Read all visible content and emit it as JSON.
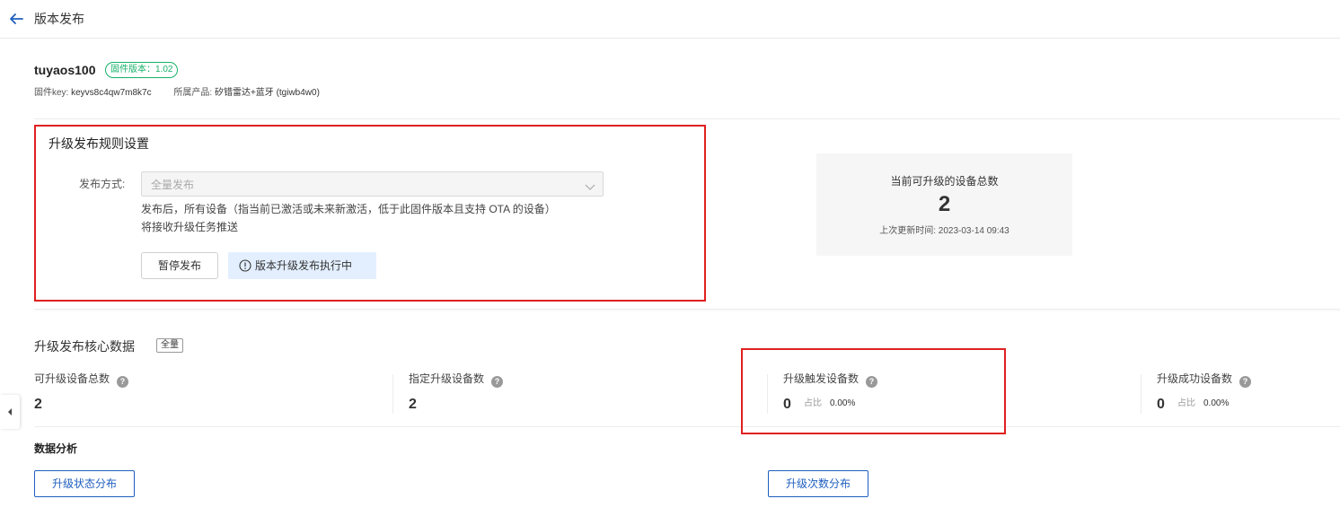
{
  "header": {
    "title": "版本发布"
  },
  "firmware": {
    "name": "tuyaos100",
    "version_tag": "固件版本：1.02",
    "key_label": "固件key:",
    "key_value": "keyvs8c4qw7m8k7c",
    "product_label": "所属产品:",
    "product_value": "矽错雷达+蓝牙 (tgiwb4w0)"
  },
  "release_rules": {
    "title": "升级发布规则设置",
    "method_label": "发布方式:",
    "method_value": "全量发布",
    "description_line1": "发布后，所有设备（指当前已激活或未来新激活，低于此固件版本且支持 OTA 的设备）",
    "description_line2": "将接收升级任务推送",
    "pause_button": "暂停发布",
    "status_text": "版本升级发布执行中"
  },
  "upgradable_count": {
    "label": "当前可升级的设备总数",
    "value": "2",
    "last_updated": "上次更新时间: 2023-03-14 09:43"
  },
  "core_data": {
    "title": "升级发布核心数据",
    "tag": "全量",
    "metrics": [
      {
        "label": "可升级设备总数",
        "value": "2"
      },
      {
        "label": "指定升级设备数",
        "value": "2"
      },
      {
        "label": "升级触发设备数",
        "value": "0",
        "ratio_label": "占比",
        "ratio": "0.00%"
      },
      {
        "label": "升级成功设备数",
        "value": "0",
        "ratio_label": "占比",
        "ratio": "0.00%"
      }
    ]
  },
  "analysis": {
    "title": "数据分析",
    "status_dist_button": "升级状态分布",
    "count_dist_button": "升级次数分布"
  },
  "colors": {
    "accent": "#1f5fbf",
    "success": "#17b26a",
    "highlight": "#e02020"
  },
  "icons": [
    "back-arrow-icon",
    "chevron-down-icon",
    "info-circle-icon",
    "help-icon",
    "chevron-left-icon"
  ]
}
